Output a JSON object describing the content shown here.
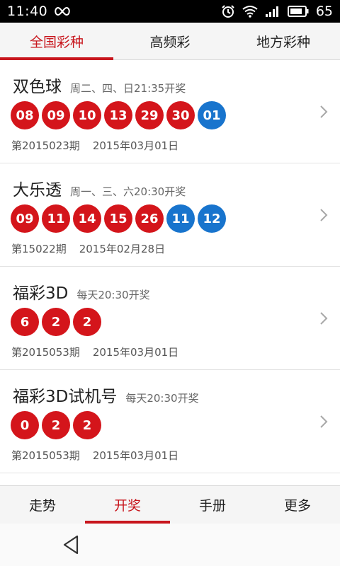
{
  "status_bar": {
    "time": "11:40",
    "battery": "65"
  },
  "top_tabs": [
    {
      "label": "全国彩种",
      "active": true
    },
    {
      "label": "高频彩",
      "active": false
    },
    {
      "label": "地方彩种",
      "active": false
    }
  ],
  "lotteries": [
    {
      "name": "双色球",
      "schedule": "周二、四、日21:35开奖",
      "red_balls": [
        "08",
        "09",
        "10",
        "13",
        "29",
        "30"
      ],
      "blue_balls": [
        "01"
      ],
      "issue": "第2015023期",
      "date": "2015年03月01日"
    },
    {
      "name": "大乐透",
      "schedule": "周一、三、六20:30开奖",
      "red_balls": [
        "09",
        "11",
        "14",
        "15",
        "26"
      ],
      "blue_balls": [
        "11",
        "12"
      ],
      "issue": "第15022期",
      "date": "2015年02月28日"
    },
    {
      "name": "福彩3D",
      "schedule": "每天20:30开奖",
      "red_balls": [
        "6",
        "2",
        "2"
      ],
      "blue_balls": [],
      "issue": "第2015053期",
      "date": "2015年03月01日"
    },
    {
      "name": "福彩3D试机号",
      "schedule": "每天20:30开奖",
      "red_balls": [
        "0",
        "2",
        "2"
      ],
      "blue_balls": [],
      "issue": "第2015053期",
      "date": "2015年03月01日"
    }
  ],
  "bottom_nav": [
    {
      "label": "走势",
      "active": false
    },
    {
      "label": "开奖",
      "active": true
    },
    {
      "label": "手册",
      "active": false
    },
    {
      "label": "更多",
      "active": false
    }
  ],
  "colors": {
    "accent": "#c8161d",
    "red_ball": "#d4151b",
    "blue_ball": "#1874cd"
  },
  "icons": {
    "status": [
      "infinity-icon",
      "alarm-icon",
      "wifi-icon",
      "signal-icon",
      "battery-icon"
    ],
    "chevron": "chevron-right-icon",
    "back": "back-triangle-icon"
  }
}
